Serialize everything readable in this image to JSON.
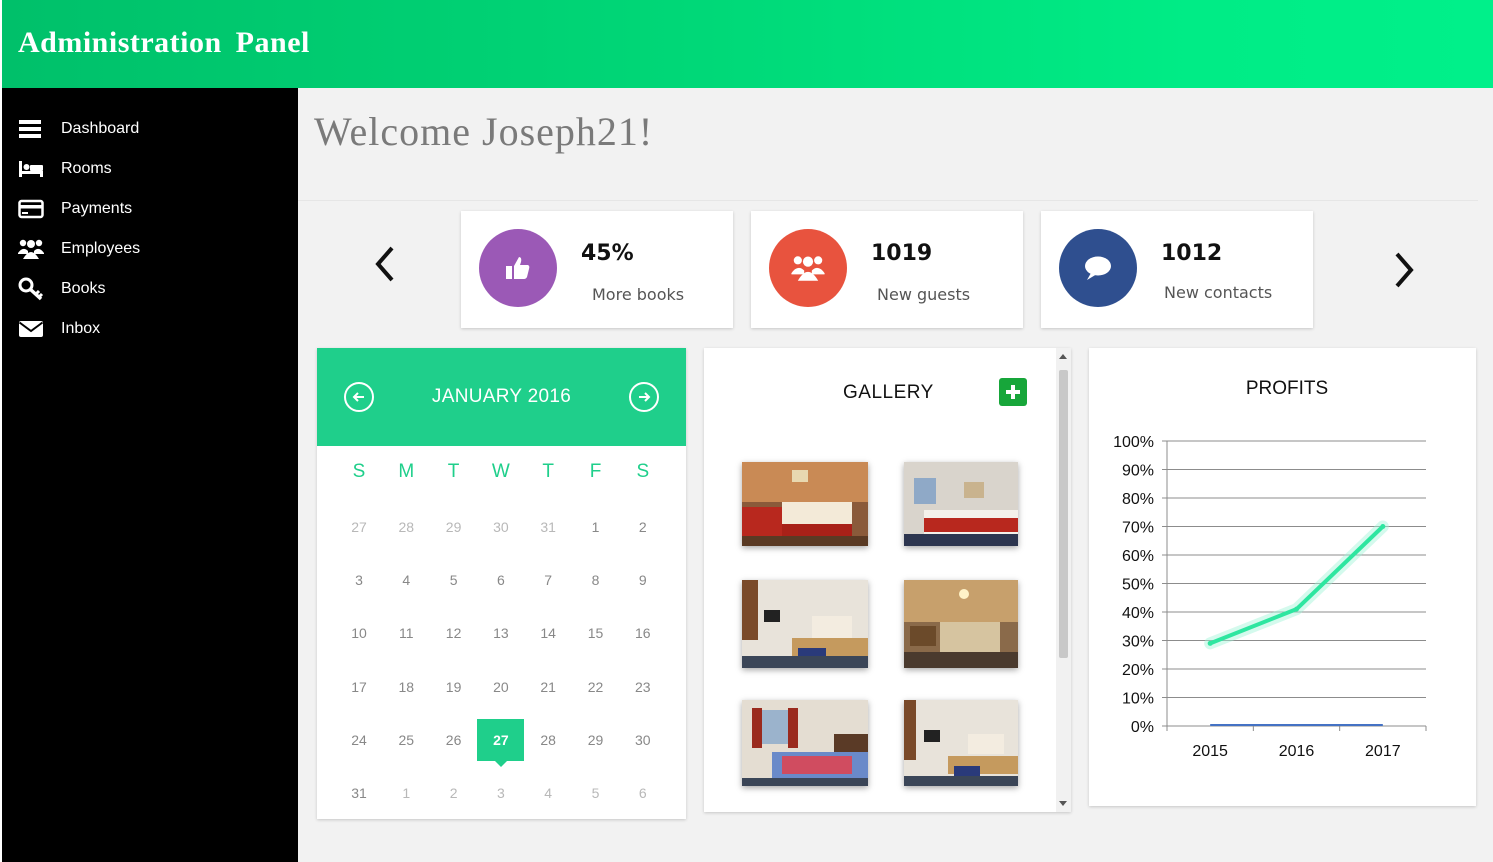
{
  "header": {
    "title": "Administration  Panel"
  },
  "sidebar": {
    "items": [
      {
        "label": "Dashboard",
        "icon": "menu-icon"
      },
      {
        "label": "Rooms",
        "icon": "bed-icon"
      },
      {
        "label": "Payments",
        "icon": "credit-card-icon"
      },
      {
        "label": "Employees",
        "icon": "users-icon"
      },
      {
        "label": "Books",
        "icon": "key-icon"
      },
      {
        "label": "Inbox",
        "icon": "envelope-icon"
      }
    ]
  },
  "main": {
    "welcome": "Welcome Joseph21!"
  },
  "stats": [
    {
      "value": "45%",
      "label": "More books",
      "icon": "thumbs-up-icon",
      "color": "#9b59b6"
    },
    {
      "value": "1019",
      "label": "New guests",
      "icon": "users-icon",
      "color": "#e8533e"
    },
    {
      "value": "1012",
      "label": "New contacts",
      "icon": "chat-bubble-icon",
      "color": "#2f4f8f"
    }
  ],
  "calendar": {
    "month": "JANUARY 2016",
    "weekdays": [
      "S",
      "M",
      "T",
      "W",
      "T",
      "F",
      "S"
    ],
    "weeks": [
      [
        "27",
        "28",
        "29",
        "30",
        "31",
        "1",
        "2"
      ],
      [
        "3",
        "4",
        "5",
        "6",
        "7",
        "8",
        "9"
      ],
      [
        "10",
        "11",
        "12",
        "13",
        "14",
        "15",
        "16"
      ],
      [
        "17",
        "18",
        "19",
        "20",
        "21",
        "22",
        "23"
      ],
      [
        "24",
        "25",
        "26",
        "27",
        "28",
        "29",
        "30"
      ],
      [
        "31",
        "1",
        "2",
        "3",
        "4",
        "5",
        "6"
      ]
    ],
    "selected": "27",
    "accent": "#1fcf8b"
  },
  "gallery": {
    "title": "GALLERY",
    "photo_count": 6
  },
  "profits": {
    "title": "PROFITS"
  },
  "chart_data": {
    "type": "line",
    "title": "PROFITS",
    "categories": [
      "2015",
      "2016",
      "2017"
    ],
    "series": [
      {
        "values": [
          0.29,
          0.41,
          0.7
        ],
        "color": "#2ee6a0"
      },
      {
        "values": [
          0,
          0,
          0
        ],
        "color": "#4472c4"
      }
    ],
    "ylim": [
      0,
      1
    ],
    "yticks": [
      "0%",
      "10%",
      "20%",
      "30%",
      "40%",
      "50%",
      "60%",
      "70%",
      "80%",
      "90%",
      "100%"
    ],
    "grid": true
  }
}
